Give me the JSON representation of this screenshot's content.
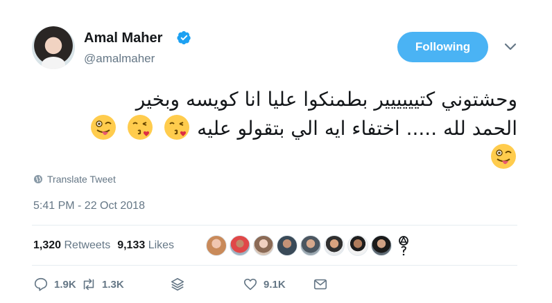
{
  "user": {
    "display_name": "Amal Maher",
    "handle": "@amalmaher",
    "verified_icon": "verified-badge-icon",
    "avatar_icon": "profile-avatar"
  },
  "follow": {
    "label": "Following",
    "color": "#4ab3f4"
  },
  "tweet": {
    "line1": "وحشتوني كتيييييير بطمنكوا عليا انا كويسه وبخير",
    "line2": "الحمد لله ..... اختفاء ايه الي بتقولو عليه",
    "emojis_line2": [
      "kissing-face-with-heart-icon",
      "kissing-face-with-heart-icon",
      "winking-tongue-face-icon"
    ],
    "emojis_line3": [
      "winking-tongue-face-icon"
    ]
  },
  "translate": {
    "label": "Translate Tweet"
  },
  "timestamp": "5:41 PM - 22 Oct 2018",
  "stats": {
    "retweets_count": "1,320",
    "retweets_label": "Retweets",
    "likes_count": "9,133",
    "likes_label": "Likes"
  },
  "actions": {
    "reply_count": "1.9K",
    "retweet_count": "1.3K",
    "like_count": "9.1K"
  },
  "colors": {
    "text": "#14171a",
    "muted": "#657786",
    "accent": "#1da1f2",
    "border": "#e6ecf0"
  }
}
